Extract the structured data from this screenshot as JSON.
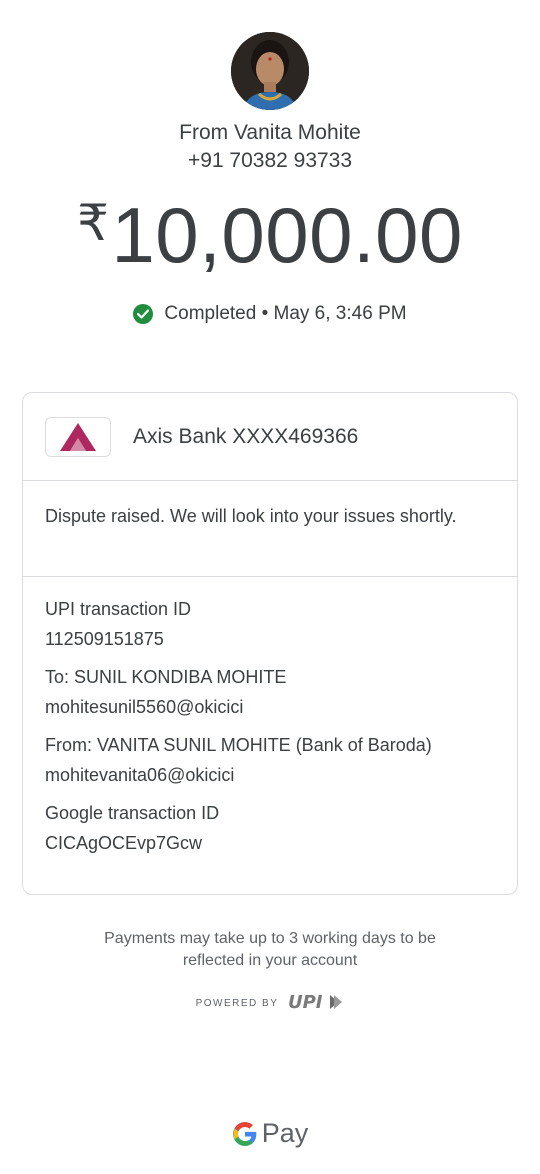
{
  "sender": {
    "from_label": "From Vanita Mohite",
    "phone": "+91 70382 93733"
  },
  "amount": {
    "currency": "₹",
    "value": "10,000.00"
  },
  "status": {
    "text": "Completed • May 6, 3:46 PM",
    "color": "#1e8e3e"
  },
  "bank": {
    "name": "Axis Bank XXXX469366",
    "logo_color": "#ae275f"
  },
  "dispute": {
    "text": "Dispute raised. We will look into your issues shortly."
  },
  "details": {
    "upi_label": "UPI transaction ID",
    "upi_value": "112509151875",
    "to_label": "To: SUNIL KONDIBA MOHITE",
    "to_value": "mohitesunil5560@okicici",
    "from_label": "From: VANITA SUNIL MOHITE (Bank of Baroda)",
    "from_value": "mohitevanita06@okicici",
    "google_label": "Google transaction ID",
    "google_value": "CICAgOCEvp7Gcw"
  },
  "footer": {
    "note_line1": "Payments may take up to 3 working days to be",
    "note_line2": "reflected in your account",
    "powered_by": "POWERED BY",
    "upi_logo_text": "UPI",
    "brand_pay": "Pay"
  }
}
